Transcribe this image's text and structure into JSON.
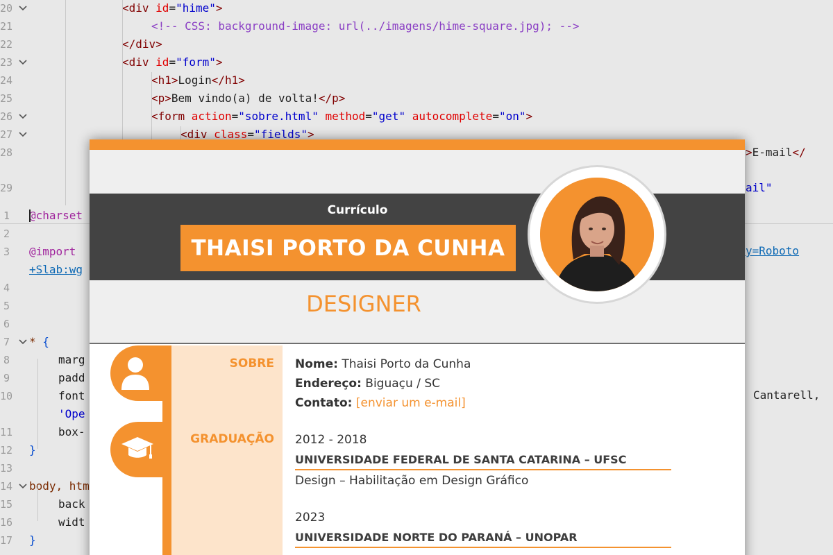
{
  "editor": {
    "top_lines": [
      {
        "num": "20",
        "fold": true,
        "indent": 176,
        "tokens": [
          [
            "tag",
            "<div "
          ],
          [
            "attr",
            "id"
          ],
          [
            "plain",
            "="
          ],
          [
            "str",
            "\"hime\""
          ],
          [
            "tag",
            ">"
          ]
        ]
      },
      {
        "num": "21",
        "fold": false,
        "indent": 218,
        "tokens": [
          [
            "com",
            "<!-- CSS: background-image: url(../imagens/hime-square.jpg); -->"
          ]
        ]
      },
      {
        "num": "22",
        "fold": false,
        "indent": 176,
        "tokens": [
          [
            "tag",
            "</div>"
          ]
        ]
      },
      {
        "num": "23",
        "fold": true,
        "indent": 176,
        "tokens": [
          [
            "tag",
            "<div "
          ],
          [
            "attr",
            "id"
          ],
          [
            "plain",
            "="
          ],
          [
            "str",
            "\"form\""
          ],
          [
            "tag",
            ">"
          ]
        ]
      },
      {
        "num": "24",
        "fold": false,
        "indent": 218,
        "tokens": [
          [
            "tag",
            "<h1>"
          ],
          [
            "plain",
            "Login"
          ],
          [
            "tag",
            "</h1>"
          ]
        ]
      },
      {
        "num": "25",
        "fold": false,
        "indent": 218,
        "tokens": [
          [
            "tag",
            "<p>"
          ],
          [
            "plain",
            "Bem vindo(a) de volta!"
          ],
          [
            "tag",
            "</p>"
          ]
        ]
      },
      {
        "num": "26",
        "fold": true,
        "indent": 218,
        "tokens": [
          [
            "tag",
            "<form "
          ],
          [
            "attr",
            "action"
          ],
          [
            "plain",
            "="
          ],
          [
            "str",
            "\"sobre.html\""
          ],
          [
            "attr",
            " method"
          ],
          [
            "plain",
            "="
          ],
          [
            "str",
            "\"get\""
          ],
          [
            "attr",
            " autocomplete"
          ],
          [
            "plain",
            "="
          ],
          [
            "str",
            "\"on\""
          ],
          [
            "tag",
            ">"
          ]
        ]
      },
      {
        "num": "27",
        "fold": true,
        "indent": 260,
        "tokens": [
          [
            "tag",
            "<div "
          ],
          [
            "attr",
            "class"
          ],
          [
            "plain",
            "="
          ],
          [
            "str",
            "\"fields\""
          ],
          [
            "tag",
            ">"
          ]
        ]
      },
      {
        "num": "28",
        "fold": false,
        "indent": 1074,
        "tokens": [
          [
            "tag",
            ">"
          ],
          [
            "plain",
            "E-mail"
          ],
          [
            "tag",
            "</"
          ]
        ]
      },
      {
        "num": "29",
        "fold": false,
        "indent": 1074,
        "tokens": [
          [
            "str",
            "ail\""
          ]
        ]
      }
    ],
    "bottom_lines": [
      {
        "num": "1",
        "fold": false,
        "indent": 42,
        "tokens": [
          [
            "kw",
            "@charset"
          ]
        ]
      },
      {
        "num": "2",
        "fold": false,
        "indent": 42,
        "tokens": []
      },
      {
        "num": "3",
        "fold": false,
        "indent": 42,
        "tokens": [
          [
            "kw",
            "@import "
          ]
        ]
      },
      {
        "num": "",
        "fold": false,
        "indent": 42,
        "tokens": [
          [
            "url",
            "+Slab:wg"
          ]
        ]
      },
      {
        "num": "4",
        "fold": false,
        "indent": 42,
        "tokens": []
      },
      {
        "num": "5",
        "fold": false,
        "indent": 42,
        "tokens": []
      },
      {
        "num": "6",
        "fold": false,
        "indent": 42,
        "tokens": []
      },
      {
        "num": "7",
        "fold": true,
        "indent": 42,
        "tokens": [
          [
            "sel",
            "* "
          ],
          [
            "brace",
            "{"
          ]
        ]
      },
      {
        "num": "8",
        "fold": false,
        "indent": 84,
        "tokens": [
          [
            "prop",
            "marg"
          ]
        ]
      },
      {
        "num": "9",
        "fold": false,
        "indent": 84,
        "tokens": [
          [
            "prop",
            "padd"
          ]
        ]
      },
      {
        "num": "10",
        "fold": false,
        "indent": 84,
        "tokens": [
          [
            "prop",
            "font"
          ]
        ]
      },
      {
        "num": "",
        "fold": false,
        "indent": 84,
        "tokens": [
          [
            "str",
            "'Ope"
          ]
        ]
      },
      {
        "num": "11",
        "fold": false,
        "indent": 84,
        "tokens": [
          [
            "prop",
            "box-"
          ]
        ]
      },
      {
        "num": "12",
        "fold": false,
        "indent": 42,
        "tokens": [
          [
            "brace",
            "}"
          ]
        ]
      },
      {
        "num": "13",
        "fold": false,
        "indent": 42,
        "tokens": []
      },
      {
        "num": "14",
        "fold": true,
        "indent": 42,
        "tokens": [
          [
            "sel",
            "body, htm"
          ]
        ]
      },
      {
        "num": "15",
        "fold": false,
        "indent": 84,
        "tokens": [
          [
            "prop",
            "back"
          ]
        ]
      },
      {
        "num": "16",
        "fold": false,
        "indent": 84,
        "tokens": [
          [
            "prop",
            "widt"
          ]
        ]
      },
      {
        "num": "17",
        "fold": false,
        "indent": 42,
        "tokens": [
          [
            "brace",
            "}"
          ]
        ]
      }
    ],
    "right_fragments": {
      "url_tail": "y=Roboto",
      "cantarell": "Cantarell,"
    }
  },
  "resume": {
    "subtitle": "Currículo",
    "name": "THAISI PORTO DA CUNHA",
    "role": "DESIGNER",
    "sections": {
      "about_label": "SOBRE",
      "education_label": "GRADUAÇÃO"
    },
    "about": {
      "name_label": "Nome:",
      "name_value": " Thaisi Porto da Cunha",
      "address_label": "Endereço:",
      "address_value": " Biguaçu / SC",
      "contact_label": "Contato:",
      "contact_link": "[enviar um e-mail]"
    },
    "education": [
      {
        "years": "2012 - 2018",
        "school": "UNIVERSIDADE FEDERAL DE SANTA CATARINA – UFSC",
        "course": "Design – Habilitação em Design Gráfico"
      },
      {
        "years": "2023",
        "school": "UNIVERSIDADE NORTE DO PARANÁ – UNOPAR",
        "course": ""
      }
    ],
    "colors": {
      "accent": "#f4922f",
      "dark": "#434343",
      "light": "#efefef",
      "pale": "#fde4cb"
    },
    "icons": [
      "user-icon",
      "graduation-cap-icon"
    ]
  }
}
